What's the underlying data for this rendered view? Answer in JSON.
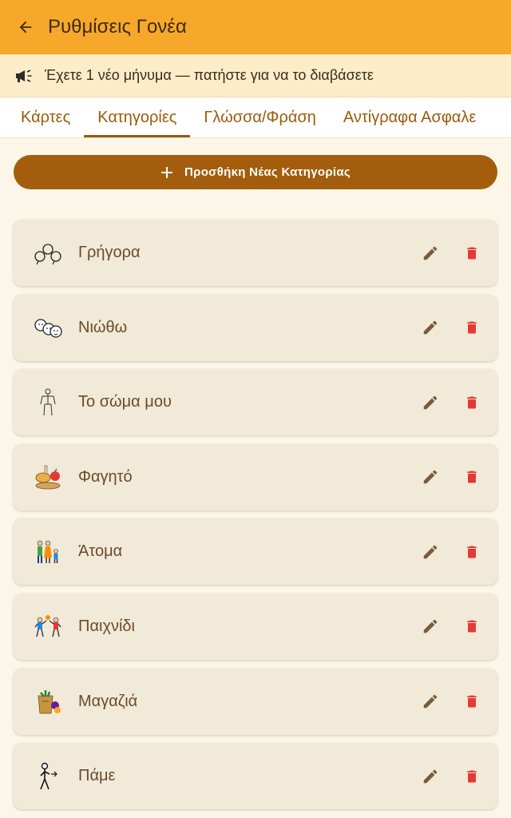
{
  "appbar": {
    "title": "Ρυθμίσεις Γονέα",
    "back_icon": "arrow-back-icon"
  },
  "banner": {
    "icon": "megaphone-icon",
    "text": "Έχετε 1 νέο μήνυμα — πατήστε για να το διαβάσετε"
  },
  "tabs": [
    {
      "label": "Κάρτες",
      "active": false
    },
    {
      "label": "Κατηγορίες",
      "active": true
    },
    {
      "label": "Γλώσσα/Φράση",
      "active": false
    },
    {
      "label": "Αντίγραφα Ασφαλε",
      "active": false
    }
  ],
  "add_button": {
    "label": "Προσθήκη Νέας Κατηγορίας",
    "icon": "plus-icon"
  },
  "categories": [
    {
      "label": "Γρήγορα",
      "icon": "speech-bubbles-icon"
    },
    {
      "label": "Νιώθω",
      "icon": "faces-icon"
    },
    {
      "label": "Το σώμα μου",
      "icon": "body-outline-icon"
    },
    {
      "label": "Φαγητό",
      "icon": "food-icon"
    },
    {
      "label": "Άτομα",
      "icon": "family-icon"
    },
    {
      "label": "Παιχνίδι",
      "icon": "play-icon"
    },
    {
      "label": "Μαγαζιά",
      "icon": "shopping-bag-icon"
    },
    {
      "label": "Πάμε",
      "icon": "walking-person-icon"
    }
  ],
  "colors": {
    "appbar": "#F6A82A",
    "banner": "#FCEDC8",
    "accent": "#A35D0C",
    "card": "#F1EAD9",
    "delete": "#E53935",
    "edit": "#7A5A3A"
  }
}
